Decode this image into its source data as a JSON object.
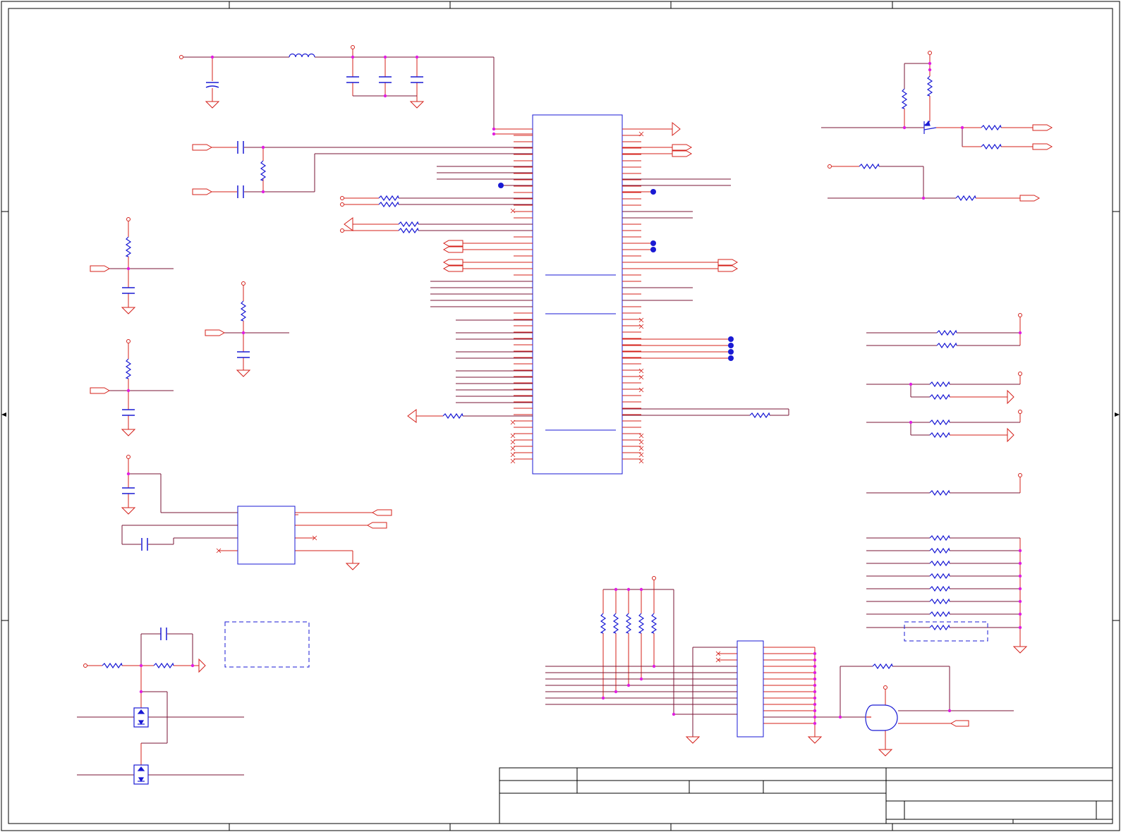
{
  "title_block": {
    "visible_text": []
  },
  "colors": {
    "wire": "#d4201a",
    "trace": "#7a1436",
    "component": "#1a1ad4",
    "junction": "#e01ee0",
    "frame": "#000000",
    "background": "#ffffff"
  }
}
